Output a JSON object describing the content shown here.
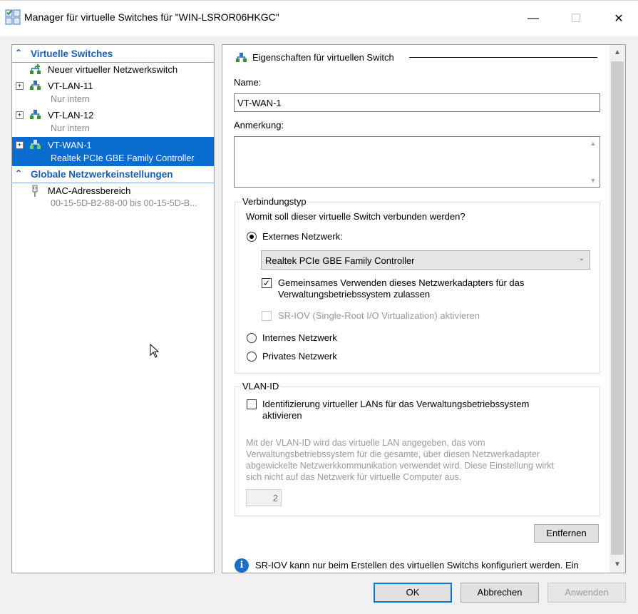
{
  "window": {
    "title": "Manager für virtuelle Switches für \"WIN-LSROR06HKGC\"",
    "controls": {
      "minimize": "—",
      "maximize": "☐",
      "close": "✕"
    }
  },
  "left": {
    "section_switches": "Virtuelle Switches",
    "new_switch": "Neuer virtueller Netzwerkswitch",
    "switches": [
      {
        "name": "VT-LAN-11",
        "detail": "Nur intern"
      },
      {
        "name": "VT-LAN-12",
        "detail": "Nur intern"
      },
      {
        "name": "VT-WAN-1",
        "detail": "Realtek PCIe GBE Family Controller"
      }
    ],
    "section_global": "Globale Netzwerkeinstellungen",
    "mac": {
      "name": "MAC-Adressbereich",
      "detail": "00-15-5D-B2-88-00 bis 00-15-5D-B..."
    }
  },
  "props": {
    "header": "Eigenschaften für virtuellen Switch",
    "name_label": "Name:",
    "name_value": "VT-WAN-1",
    "note_label": "Anmerkung:",
    "note_value": "",
    "conn": {
      "title": "Verbindungstyp",
      "question": "Womit soll dieser virtuelle Switch verbunden werden?",
      "external": "Externes Netzwerk:",
      "adapter": "Realtek PCIe GBE Family Controller",
      "share_line1": "Gemeinsames Verwenden dieses Netzwerkadapters für das",
      "share_line2": "Verwaltungsbetriebssystem zulassen",
      "sriov": "SR-IOV (Single-Root I/O Virtualization) aktivieren",
      "internal": "Internes Netzwerk",
      "private": "Privates Netzwerk"
    },
    "vlan": {
      "title": "VLAN-ID",
      "check_line1": "Identifizierung virtueller LANs für das Verwaltungsbetriebssystem",
      "check_line2": "aktivieren",
      "desc1": "Mit der VLAN-ID wird das virtuelle LAN angegeben, das vom",
      "desc2": "Verwaltungsbetriebssystem für die gesamte, über diesen Netzwerkadapter",
      "desc3": "abgewickelte Netzwerkkommunikation verwendet wird. Diese Einstellung wirkt",
      "desc4": "sich nicht auf das Netzwerk für virtuelle Computer aus.",
      "value": "2"
    },
    "remove": "Entfernen",
    "info": "SR-IOV kann nur beim Erstellen des virtuellen Switchs konfiguriert werden. Ein"
  },
  "footer": {
    "ok": "OK",
    "cancel": "Abbrechen",
    "apply": "Anwenden"
  },
  "colors": {
    "accent": "#0a6ccf",
    "section_text": "#1a5fb4"
  }
}
